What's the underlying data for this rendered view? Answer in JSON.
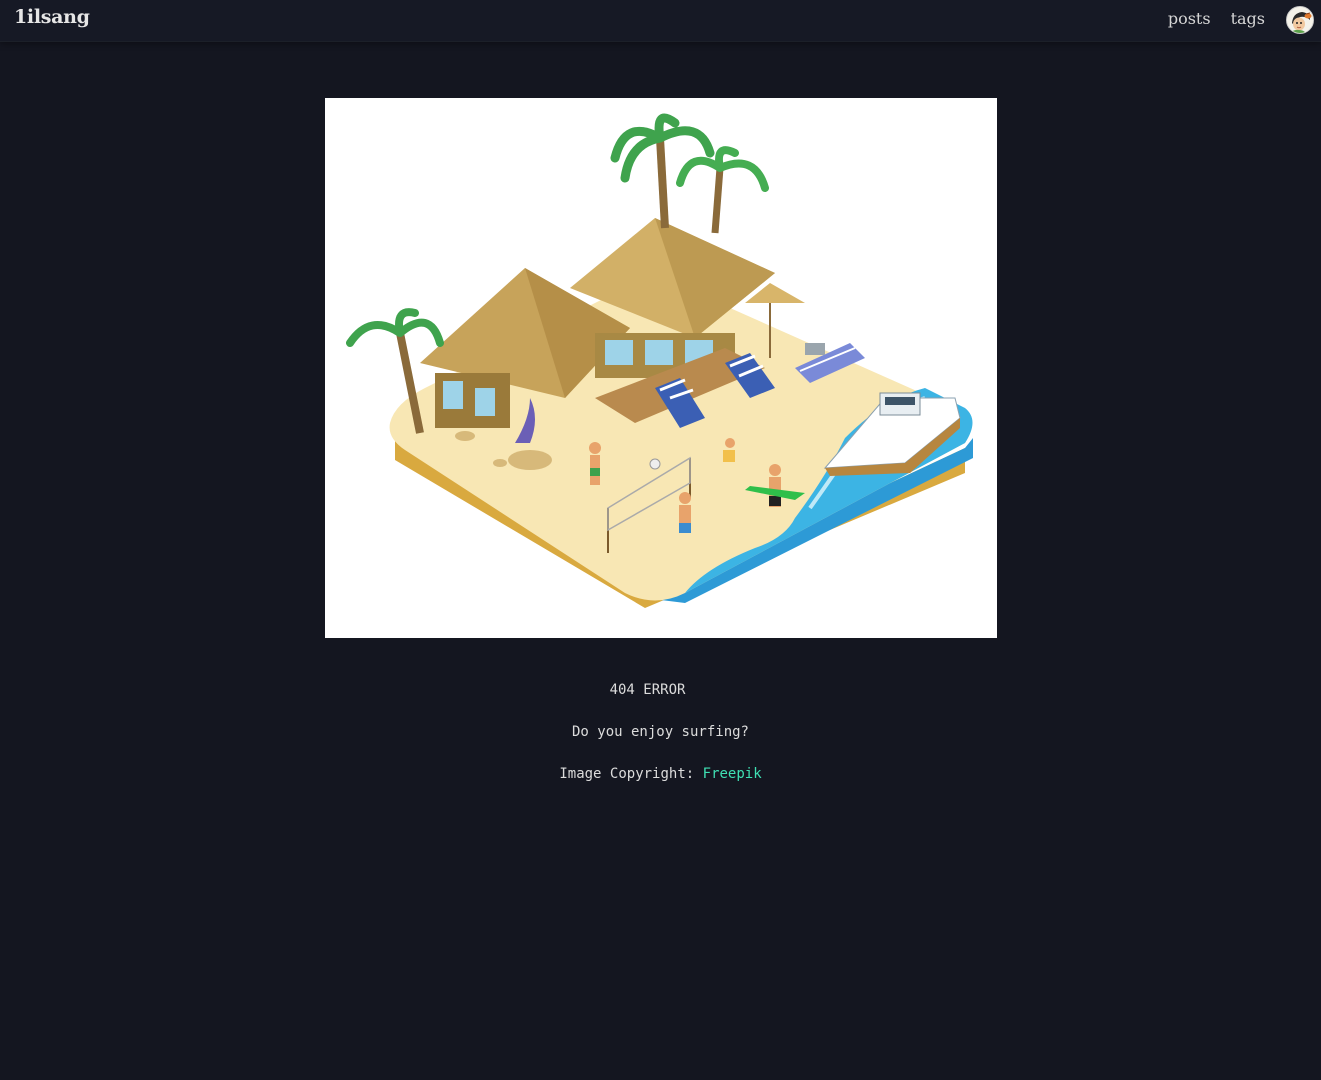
{
  "site": {
    "logo": "1ilsang"
  },
  "nav": {
    "links": [
      "posts",
      "tags"
    ]
  },
  "error": {
    "title": "404 ERROR",
    "message": "Do you enjoy surfing?",
    "copyright_label": "Image Copyright:",
    "copyright_link": "Freepik"
  },
  "colors": {
    "background": "#141620",
    "navbar": "#161925",
    "link_accent": "#3fe0b3"
  }
}
